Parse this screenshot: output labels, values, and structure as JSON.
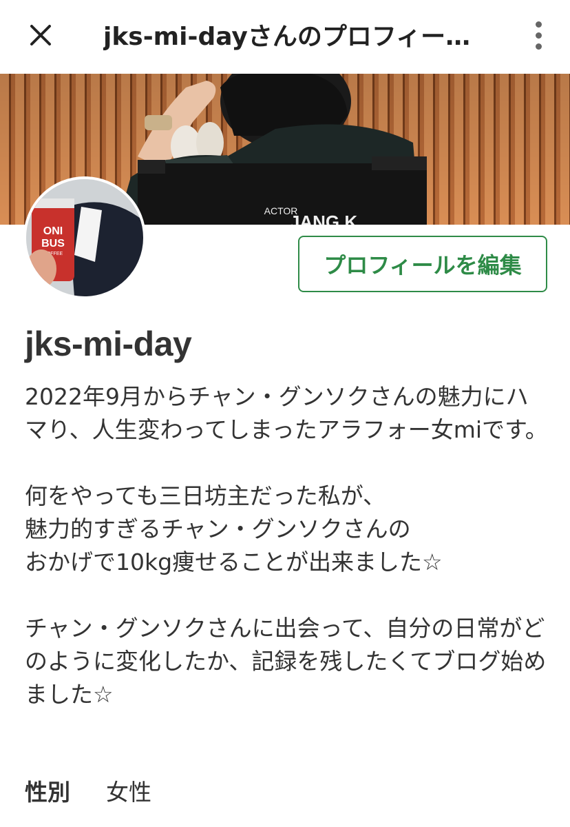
{
  "header": {
    "close_icon": "close-icon",
    "title": "jks-mi-dayさんのプロフィー…",
    "more_icon": "more-vertical-icon"
  },
  "profile": {
    "edit_button_label": "プロフィールを編集",
    "username": "jks-mi-day",
    "bio_paragraphs": [
      "2022年9月からチャン・グンソクさんの魅力にハマり、人生変わってしまったアラフォー女miです。",
      "何をやっても三日坊主だった私が、\n魅力的すぎるチャン・グンソクさんの\nおかげで10kg痩せることが出来ました☆",
      "チャン・グンソクさんに出会って、自分の日常がどのように変化したか、記録を残したくてブログ始めました☆"
    ],
    "gender_label": "性別",
    "gender_value": "女性"
  },
  "cover": {
    "chair_text_1": "ACTOR",
    "chair_text_2": "JANG  K",
    "cup_text_1": "ONI",
    "cup_text_2": "BUS",
    "cup_text_3": "COFFEE"
  },
  "colors": {
    "accent": "#2e8b47",
    "text": "#333333",
    "background": "#ffffff"
  }
}
